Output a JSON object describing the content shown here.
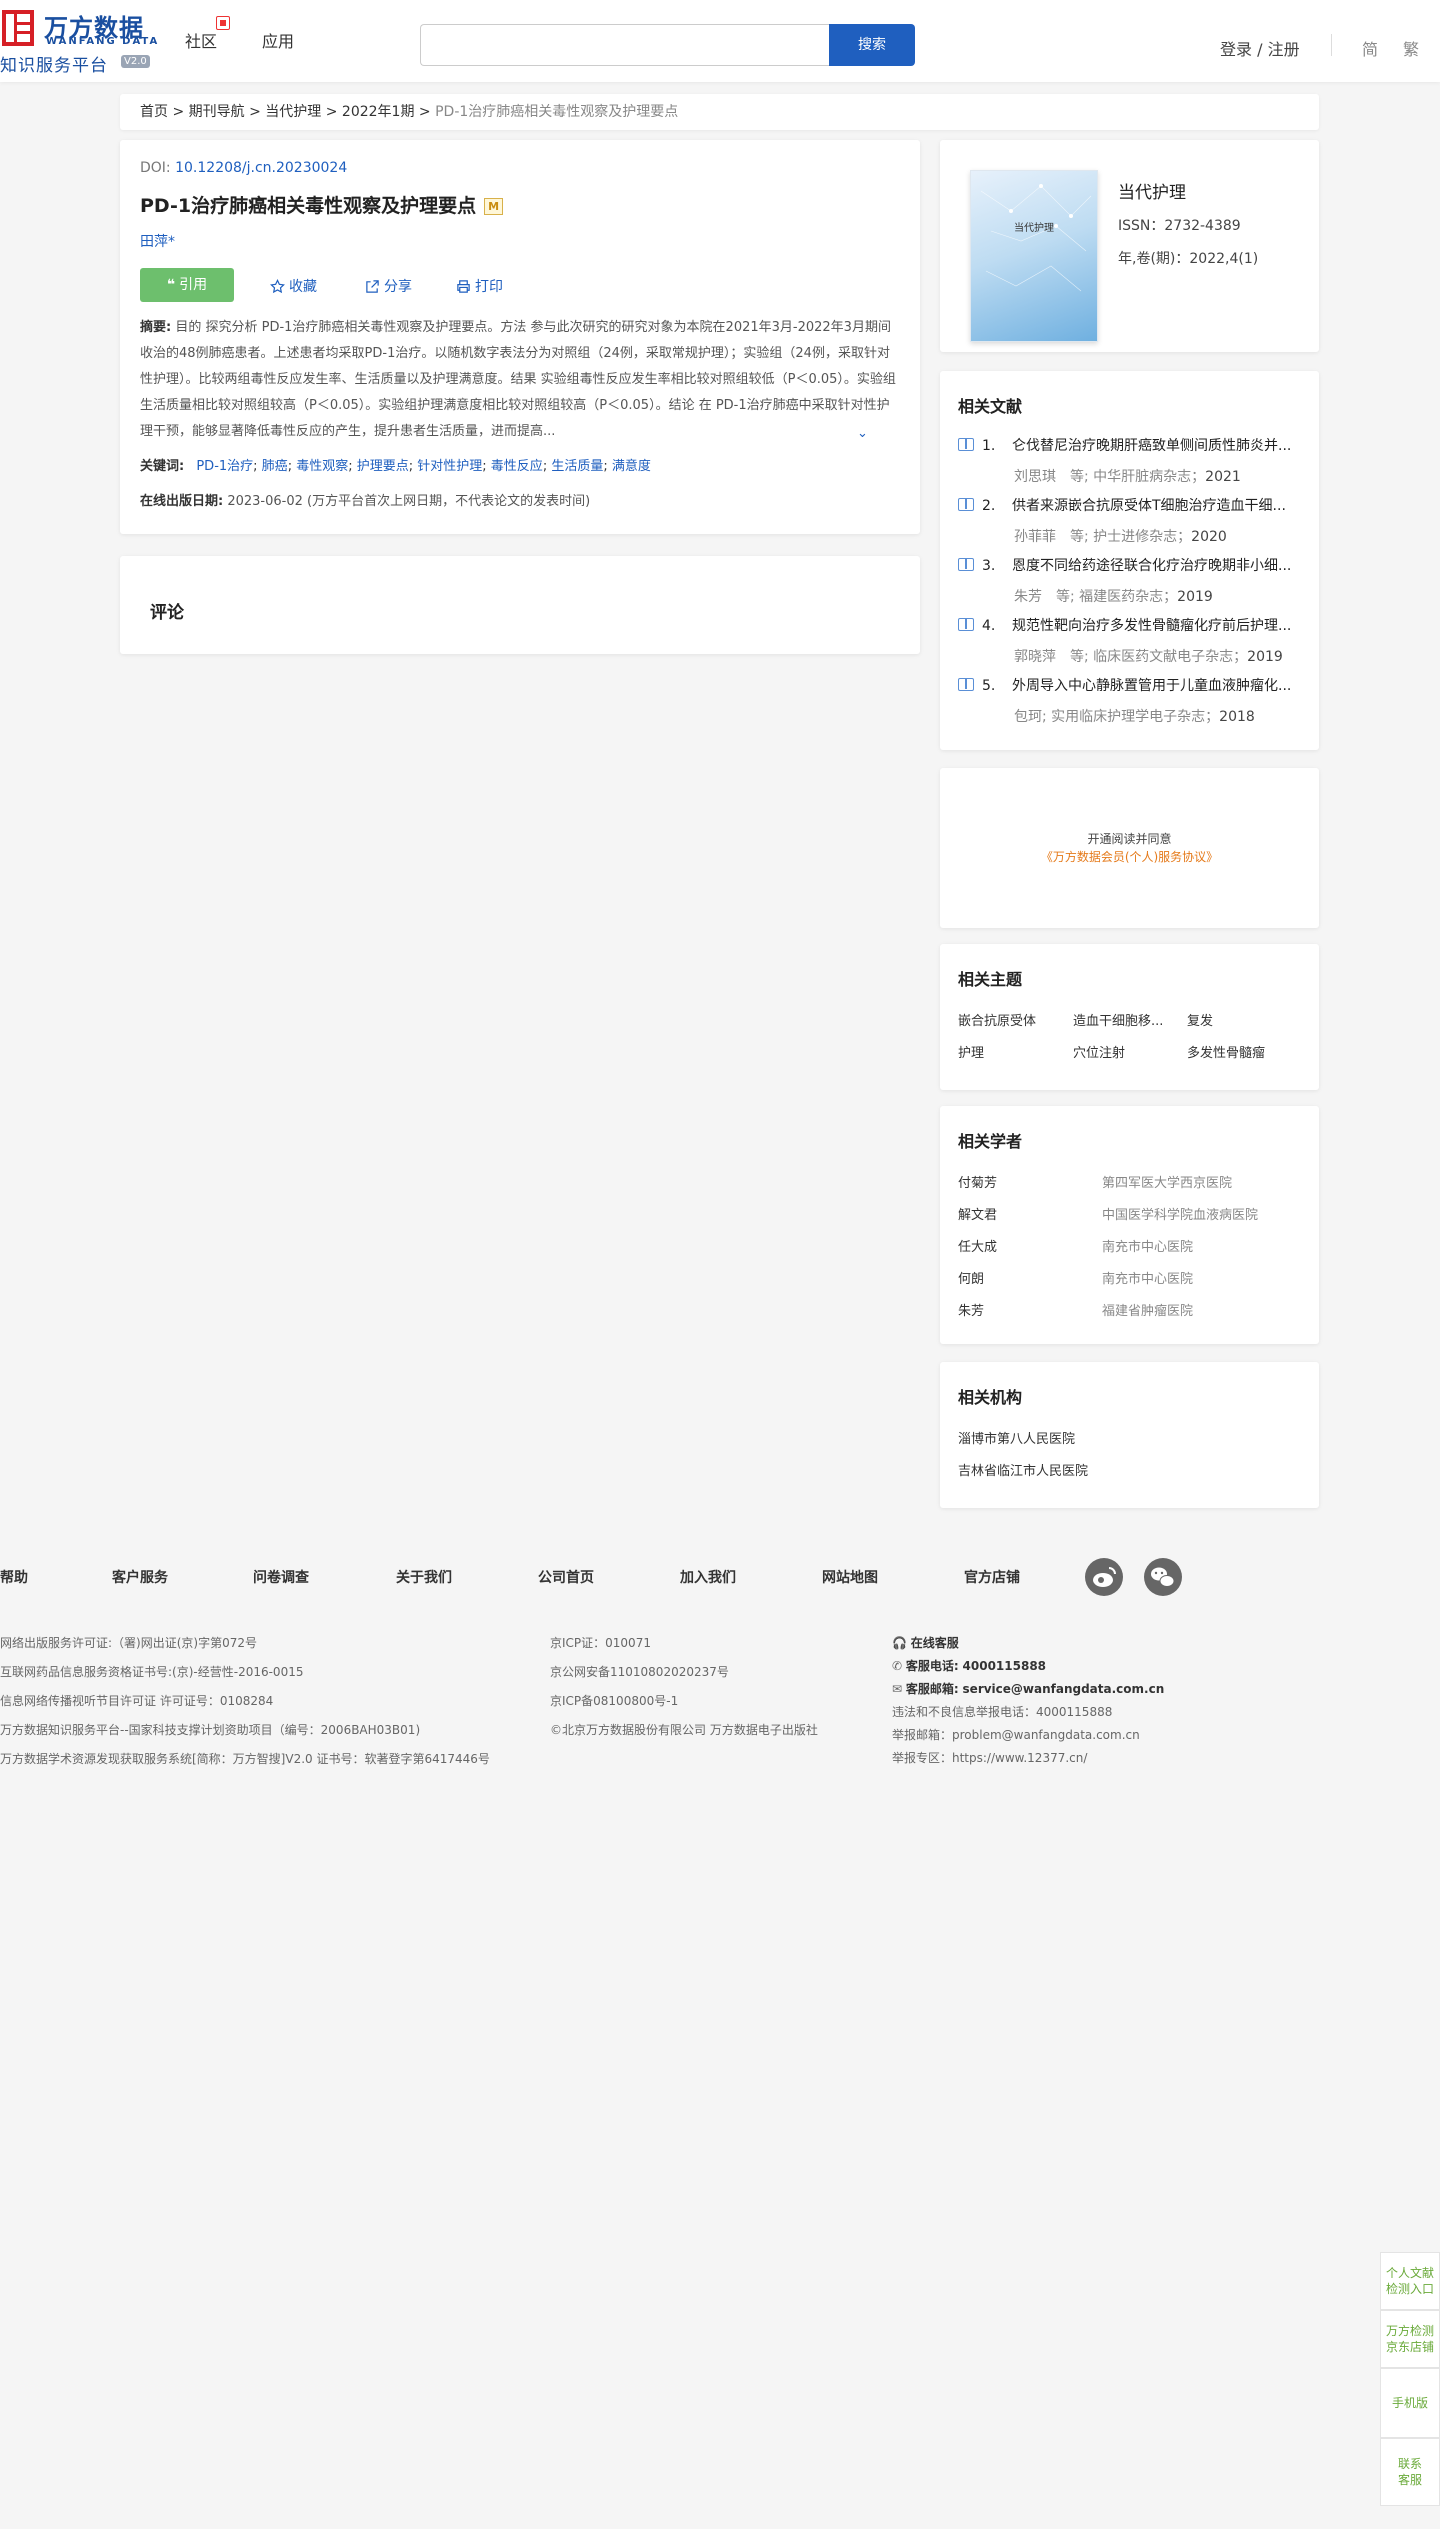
{
  "header": {
    "logo_cn": "万方数据",
    "logo_en": "WANFANG DATA",
    "logo_sub": "知识服务平台",
    "logo_ver": "V2.0",
    "nav": [
      "社区",
      "应用"
    ],
    "search_placeholder": "",
    "search_btn": "搜索",
    "login": "登录 / 注册",
    "lang_simple": "简",
    "lang_trad": "繁"
  },
  "breadcrumb": {
    "items": [
      "首页",
      "期刊导航",
      "当代护理",
      "2022年1期"
    ],
    "sep": ">",
    "current": "PD-1治疗肺癌相关毒性观察及护理要点"
  },
  "article": {
    "doi_label": "DOI:",
    "doi": "10.12208/j.cn.20230024",
    "title": "PD-1治疗肺癌相关毒性观察及护理要点",
    "badge": "M",
    "author": "田萍*",
    "cite": "引用",
    "collect": "收藏",
    "share": "分享",
    "print": "打印",
    "abstract_label": "摘要:",
    "abstract": "目的 探究分析 PD-1治疗肺癌相关毒性观察及护理要点。方法 参与此次研究的研究对象为本院在2021年3月-2022年3月期间收治的48例肺癌患者。上述患者均采取PD-1治疗。以随机数字表法分为对照组（24例，采取常规护理）；实验组（24例，采取针对性护理）。比较两组毒性反应发生率、生活质量以及护理满意度。结果 实验组毒性反应发生率相比较对照组较低（P＜0.05）。实验组生活质量相比较对照组较高（P＜0.05）。实验组护理满意度相比较对照组较高（P＜0.05）。结论 在 PD-1治疗肺癌中采取针对性护理干预，能够显著降低毒性反应的产生，提升患者生活质量，进而提高...",
    "keywords_label": "关键词:",
    "keywords": [
      "PD-1治疗",
      "肺癌",
      "毒性观察",
      "护理要点",
      "针对性护理",
      "毒性反应",
      "生活质量",
      "满意度"
    ],
    "pubdate_label": "在线出版日期:",
    "pubdate": "2023-06-02",
    "pubdate_note": "(万方平台首次上网日期，不代表论文的发表时间)",
    "comment": "评论"
  },
  "journal": {
    "cover_text": "当代护理",
    "name": "当代护理",
    "issn": "ISSN：2732-4389",
    "volume": "年,卷(期)：2022,4(1)"
  },
  "related_lit": {
    "title": "相关文献",
    "items": [
      {
        "num": "1.",
        "title": "仑伐替尼治疗晚期肝癌致单侧间质性肺炎并...",
        "authors": "刘思琪　等;",
        "source": "中华肝脏病杂志；",
        "year": "2021"
      },
      {
        "num": "2.",
        "title": "供者来源嵌合抗原受体T细胞治疗造血干细...",
        "authors": "孙菲菲　等;",
        "source": "护士进修杂志；",
        "year": "2020"
      },
      {
        "num": "3.",
        "title": "恩度不同给药途径联合化疗治疗晚期非小细...",
        "authors": "朱芳　等;",
        "source": "福建医药杂志；",
        "year": "2019"
      },
      {
        "num": "4.",
        "title": "规范性靶向治疗多发性骨髓瘤化疗前后护理...",
        "authors": "郭晓萍　等;",
        "source": "临床医药文献电子杂志；",
        "year": "2019"
      },
      {
        "num": "5.",
        "title": "外周导入中心静脉置管用于儿童血液肿瘤化...",
        "authors": "包珂;",
        "source": "实用临床护理学电子杂志；",
        "year": "2018"
      }
    ]
  },
  "service": {
    "line1": "开通阅读并同意",
    "line2": "《万方数据会员(个人)服务协议》"
  },
  "topics": {
    "title": "相关主题",
    "items": [
      "嵌合抗原受体",
      "造血干细胞移...",
      "复发",
      "护理",
      "穴位注射",
      "多发性骨髓瘤"
    ]
  },
  "scholars": {
    "title": "相关学者",
    "items": [
      {
        "name": "付菊芳",
        "org": "第四军医大学西京医院"
      },
      {
        "name": "解文君",
        "org": "中国医学科学院血液病医院"
      },
      {
        "name": "任大成",
        "org": "南充市中心医院"
      },
      {
        "name": "何朗",
        "org": "南充市中心医院"
      },
      {
        "name": "朱芳",
        "org": "福建省肿瘤医院"
      }
    ]
  },
  "orgs": {
    "title": "相关机构",
    "items": [
      "淄博市第八人民医院",
      "吉林省临江市人民医院"
    ]
  },
  "footer": {
    "links": [
      "帮助",
      "客户服务",
      "问卷调查",
      "关于我们",
      "公司首页",
      "加入我们",
      "网站地图",
      "官方店铺"
    ],
    "social": [
      "weibo-icon",
      "wechat-icon"
    ],
    "left": [
      "网络出版服务许可证:（署)网出证(京)字第072号",
      "互联网药品信息服务资格证书号:(京)-经营性-2016-0015",
      "信息网络传播视听节目许可证 许可证号：0108284",
      "万方数据知识服务平台--国家科技支撑计划资助项目（编号：2006BAH03B01)",
      "万方数据学术资源发现获取服务系统[简称：万方智搜]V2.0 证书号：软著登字第6417446号"
    ],
    "middle": [
      "京ICP证：010071",
      "京公网安备11010802020237号",
      "京ICP备08100800号-1",
      "©北京万方数据股份有限公司 万方数据电子出版社"
    ],
    "right": {
      "online": "在线客服",
      "phone_label": "客服电话:",
      "phone": "4000115888",
      "email_label": "客服邮箱:",
      "email": "service@wanfangdata.com.cn",
      "report_phone": "违法和不良信息举报电话：4000115888",
      "report_email": "举报邮箱：problem@wanfangdata.com.cn",
      "report_site": "举报专区：https://www.12377.cn/"
    }
  },
  "float": {
    "personal": "个人文献检测入口",
    "jd": "万方检测京东店铺",
    "mobile": "手机版",
    "contact": "联系客服"
  }
}
